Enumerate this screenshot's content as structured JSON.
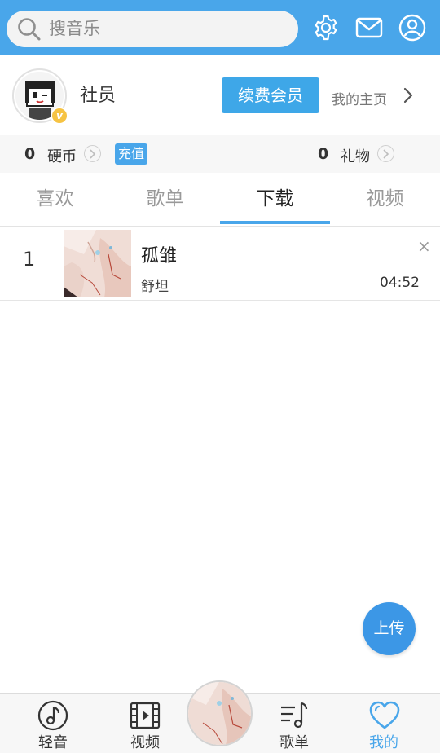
{
  "search": {
    "placeholder": "搜音乐",
    "icon": "search-icon"
  },
  "header_icons": [
    "gear-icon",
    "mail-icon",
    "user-icon"
  ],
  "profile": {
    "username": "社员",
    "renew_label": "续费会员",
    "homepage_label": "我的主页",
    "badge_label": "v"
  },
  "stats": {
    "coins_count": "0",
    "coins_label": "硬币",
    "recharge_label": "充值",
    "gifts_count": "0",
    "gifts_label": "礼物"
  },
  "tabs": [
    {
      "label": "喜欢",
      "active": false
    },
    {
      "label": "歌单",
      "active": false
    },
    {
      "label": "下载",
      "active": true
    },
    {
      "label": "视频",
      "active": false
    }
  ],
  "songs": [
    {
      "index": "1",
      "title": "孤雏",
      "artist": "舒坦",
      "duration": "04:52",
      "remove": "×"
    }
  ],
  "upload_label": "上传",
  "bottom_nav": [
    {
      "label": "轻音",
      "icon": "music-note-icon",
      "active": false
    },
    {
      "label": "视频",
      "icon": "film-icon",
      "active": false
    },
    {
      "label": "歌单",
      "icon": "playlist-icon",
      "active": false
    },
    {
      "label": "我的",
      "icon": "heart-icon",
      "active": true
    }
  ],
  "colors": {
    "accent": "#49a6ea",
    "button": "#3ea7e8",
    "badge": "#f6c343"
  }
}
